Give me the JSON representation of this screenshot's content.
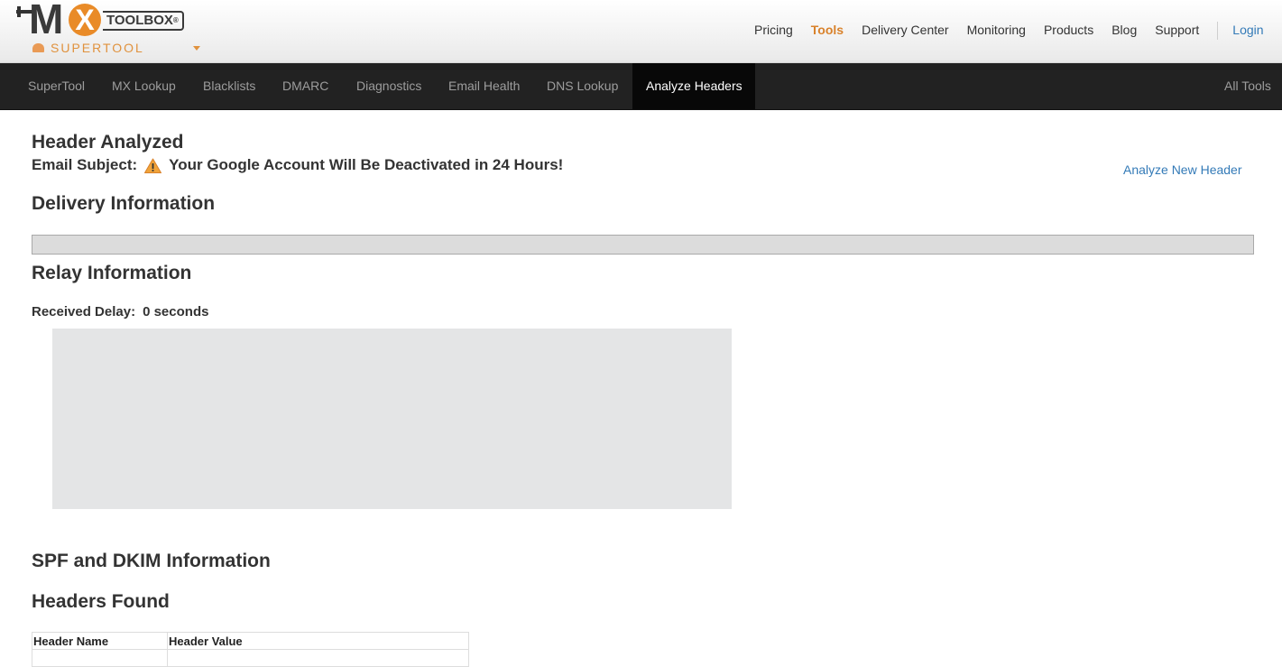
{
  "logo": {
    "mark": "M",
    "x_letter": "X",
    "wordmark": "TOOLBOX",
    "registered": "®",
    "product_label": "SUPERTOOL"
  },
  "top_nav": {
    "items": [
      {
        "label": "Pricing",
        "active": false
      },
      {
        "label": "Tools",
        "active": true
      },
      {
        "label": "Delivery Center",
        "active": false
      },
      {
        "label": "Monitoring",
        "active": false
      },
      {
        "label": "Products",
        "active": false
      },
      {
        "label": "Blog",
        "active": false
      },
      {
        "label": "Support",
        "active": false
      }
    ],
    "login_label": "Login"
  },
  "tab_bar": {
    "tabs": [
      {
        "label": "SuperTool",
        "active": false
      },
      {
        "label": "MX Lookup",
        "active": false
      },
      {
        "label": "Blacklists",
        "active": false
      },
      {
        "label": "DMARC",
        "active": false
      },
      {
        "label": "Diagnostics",
        "active": false
      },
      {
        "label": "Email Health",
        "active": false
      },
      {
        "label": "DNS Lookup",
        "active": false
      },
      {
        "label": "Analyze Headers",
        "active": true
      }
    ],
    "all_tools_label": "All Tools"
  },
  "main": {
    "title": "Header Analyzed",
    "subject_label": "Email Subject:",
    "subject_icon": "warning-icon",
    "subject_value": "Your Google Account Will Be Deactivated in 24 Hours!",
    "analyze_new_label": "Analyze New Header",
    "delivery_heading": "Delivery Information",
    "relay_heading": "Relay Information",
    "received_delay_label": "Received Delay:",
    "received_delay_value": "0 seconds",
    "spf_dkim_heading": "SPF and DKIM Information",
    "headers_found_heading": "Headers Found",
    "headers_table": {
      "columns": [
        "Header Name",
        "Header Value"
      ]
    }
  },
  "colors": {
    "accent_orange": "#d9822b",
    "link_blue": "#337ab7",
    "tabbar_bg": "#222222",
    "tab_active_bg": "#080808"
  }
}
